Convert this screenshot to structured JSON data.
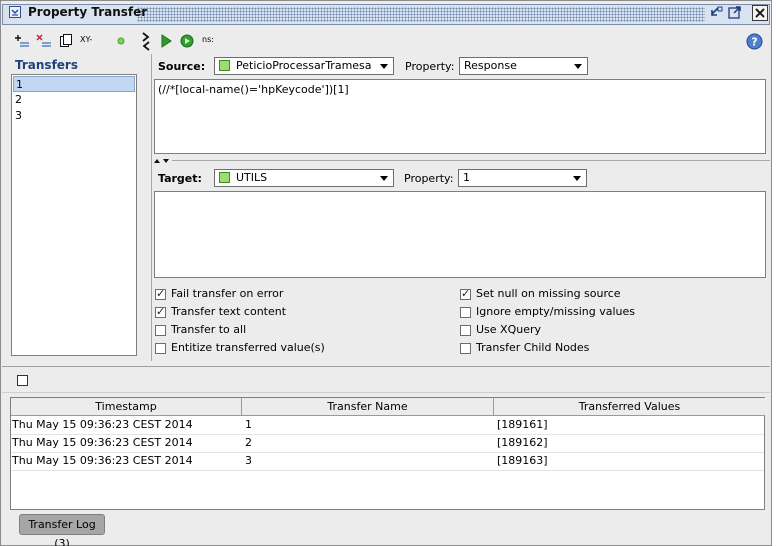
{
  "window": {
    "title": "Property Transfer",
    "buttons": [
      "minimize-icon",
      "restore-icon",
      "close-icon"
    ]
  },
  "left_toolbar": {
    "items": [
      "add-transfer-icon",
      "remove-transfer-icon",
      "copy-transfer-icon",
      "xpath-icon",
      "status-dot-icon"
    ],
    "xpath_label": "XY-"
  },
  "right_toolbar": {
    "items": [
      "run-icon",
      "run-all-icon",
      "ns-icon"
    ],
    "ns_label": "ns:",
    "help_icon": "help-icon"
  },
  "transfers": {
    "title": "Transfers",
    "items": [
      "1",
      "2",
      "3"
    ],
    "selected_index": 0
  },
  "source": {
    "label": "Source:",
    "step": "PeticioProcessarTramesa",
    "property_label": "Property:",
    "property": "Response",
    "expression": "(//*[local-name()='hpKeycode'])[1]"
  },
  "target": {
    "label": "Target:",
    "step": "UTILS",
    "property_label": "Property:",
    "property": "1",
    "expression": ""
  },
  "options": {
    "left": [
      {
        "label": "Fail transfer on error",
        "checked": true
      },
      {
        "label": "Transfer text content",
        "checked": true
      },
      {
        "label": "Transfer to all",
        "checked": false
      },
      {
        "label": "Entitize transferred value(s)",
        "checked": false
      }
    ],
    "right": [
      {
        "label": "Set null on missing source",
        "checked": true
      },
      {
        "label": "Ignore empty/missing values",
        "checked": false
      },
      {
        "label": "Use XQuery",
        "checked": false
      },
      {
        "label": "Transfer Child Nodes",
        "checked": false
      }
    ]
  },
  "log": {
    "columns": [
      "Timestamp",
      "Transfer Name",
      "Transferred Values"
    ],
    "rows": [
      [
        "Thu May 15 09:36:23 CEST 2014",
        "1",
        "[189161]"
      ],
      [
        "Thu May 15 09:36:23 CEST 2014",
        "2",
        "[189162]"
      ],
      [
        "Thu May 15 09:36:23 CEST 2014",
        "3",
        "[189163]"
      ]
    ],
    "tab_label": "Transfer Log (3)"
  },
  "colors": {
    "title_bar": "#d9e3f0",
    "selection": "#c2d8f2",
    "run_green": "#2f9e2f",
    "help_blue": "#4f7fd0"
  }
}
